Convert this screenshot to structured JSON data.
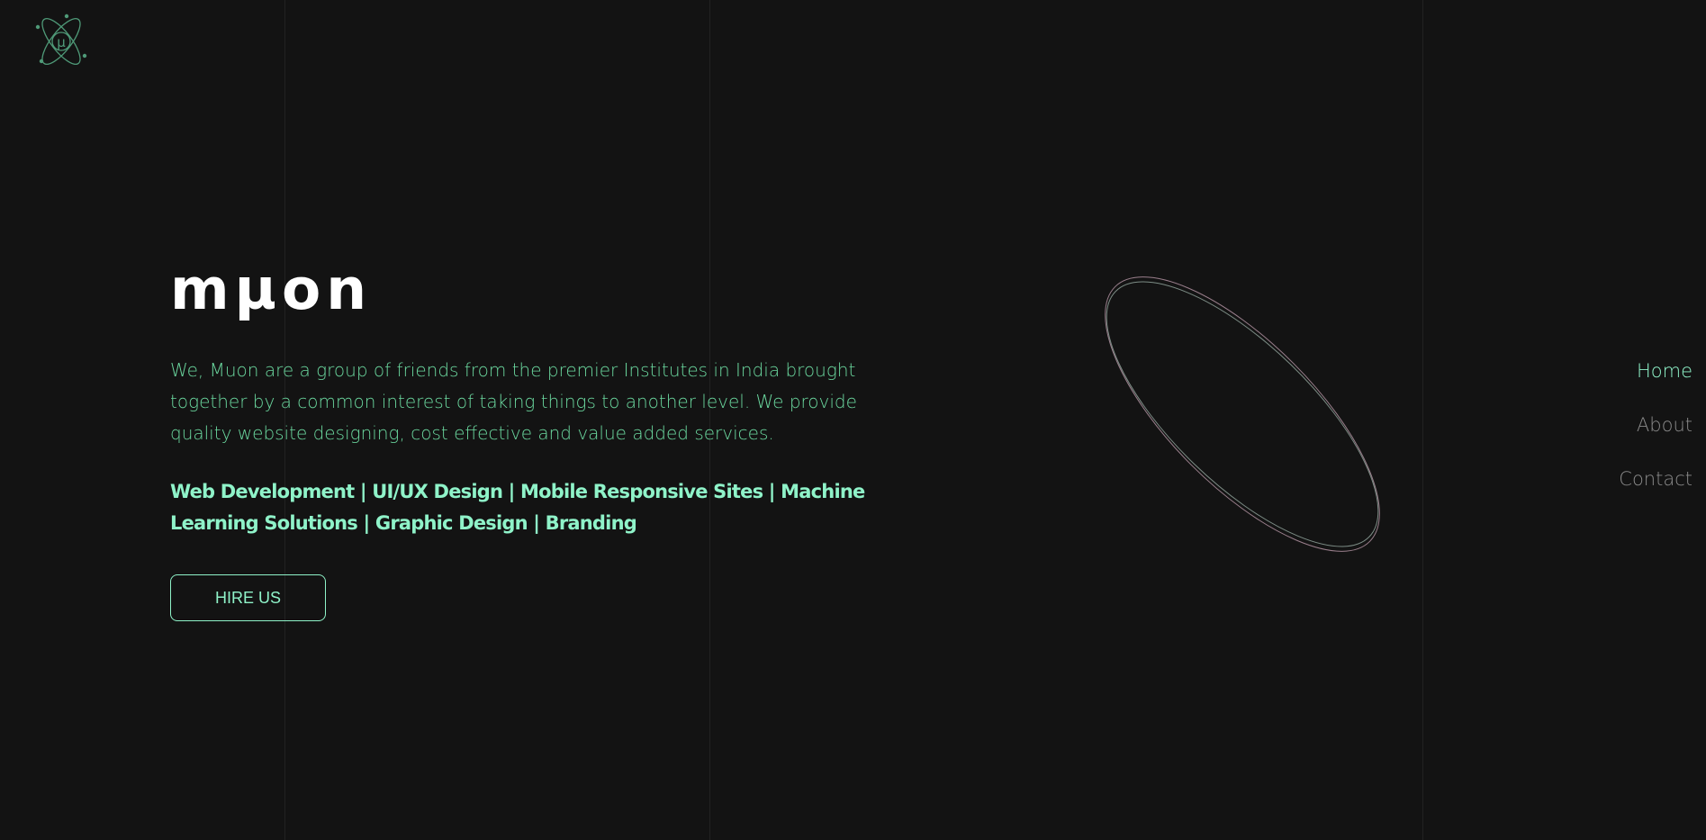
{
  "brand": {
    "title": "mµon",
    "logo_icon": "atom-mu-icon",
    "logo_letter": "µ"
  },
  "hero": {
    "intro": "We, Muon are a group of friends from the premier Institutes in India brought together by a common interest of taking things to another level. We provide quality website designing, cost effective and value added services.",
    "services": "Web Development | UI/UX Design | Mobile Responsive Sites | Machine Learning Solutions | Graphic Design | Branding",
    "cta_label": "HIRE US"
  },
  "nav": {
    "items": [
      {
        "label": "Home",
        "active": true
      },
      {
        "label": "About",
        "active": false
      },
      {
        "label": "Contact",
        "active": false
      }
    ]
  },
  "decoration": {
    "orbit_icon": "orbit-ellipse-icon"
  },
  "colors": {
    "background": "#131313",
    "accent": "#8ff3c9",
    "body_text": "#6bd89f",
    "heading": "#ffffff",
    "nav_inactive": "#8a8a8a",
    "gridline": "#222222",
    "orbit_stroke_a": "#9a7f8c",
    "orbit_stroke_b": "#7c8c85",
    "logo_stroke": "#4f9a78"
  }
}
